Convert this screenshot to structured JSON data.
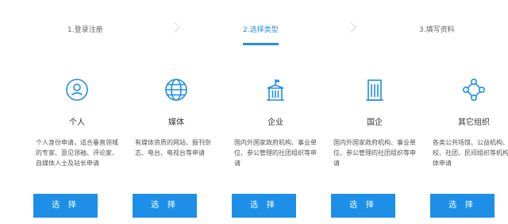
{
  "steps": [
    {
      "label": "1.登录注册"
    },
    {
      "label": "2.选择类型"
    },
    {
      "label": "3.填写资料"
    }
  ],
  "accent_color": "#1e8fe6",
  "types": [
    {
      "icon": "user-icon",
      "title": "个人",
      "desc": "个人身份申请，适合垂直领域的专家、意见领袖、评论家、自媒体人士及站长申请",
      "button": "选 择"
    },
    {
      "icon": "globe-icon",
      "title": "媒体",
      "desc": "有媒体资质的网站、报刊杂志、电台、电视台等申请",
      "button": "选 择"
    },
    {
      "icon": "government-building-icon",
      "title": "企业",
      "desc": "国内外国家政府机构、事业单位、参公管理的社团组织等申请",
      "button": "选 择"
    },
    {
      "icon": "office-building-icon",
      "title": "国企",
      "desc": "国内外国家政府机构、事业单位、参公管理的社团组织等申请",
      "button": "选 择"
    },
    {
      "icon": "network-nodes-icon",
      "title": "其它组织",
      "desc": "各类公共场馆、公益机构、学校、社团、民间组织等机构团体申请",
      "button": "选 择"
    }
  ]
}
